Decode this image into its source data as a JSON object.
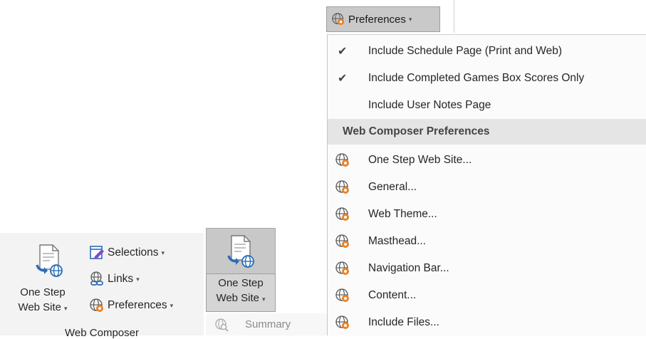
{
  "ribbon": {
    "big_button_line1": "One Step",
    "big_button_line2": "Web Site",
    "selections_label": "Selections",
    "links_label": "Links",
    "preferences_label": "Preferences",
    "group_label": "Web Composer",
    "caret": "▾"
  },
  "highlighted_button": {
    "line1": "One Step",
    "line2": "Web Site"
  },
  "summary": {
    "label": "Summary"
  },
  "preferences_menu": {
    "button_label": "Preferences",
    "items": [
      {
        "label": "Include Schedule Page (Print and Web)",
        "checked": true
      },
      {
        "label": "Include Completed Games Box Scores Only",
        "checked": true
      },
      {
        "label": "Include User Notes Page",
        "checked": false
      }
    ],
    "section_header": "Web Composer Preferences",
    "composer_items": [
      {
        "label": "One Step Web Site..."
      },
      {
        "label": "General..."
      },
      {
        "label": "Web Theme..."
      },
      {
        "label": "Masthead..."
      },
      {
        "label": "Navigation Bar..."
      },
      {
        "label": "Content..."
      },
      {
        "label": "Include Files..."
      }
    ],
    "check_glyph": "✔"
  },
  "colors": {
    "accent_blue": "#2b6cb8",
    "accent_orange": "#e8832a",
    "accent_purple": "#7a4fc9",
    "menu_background": "#fbfbfb",
    "header_background": "#e5e5e5"
  }
}
